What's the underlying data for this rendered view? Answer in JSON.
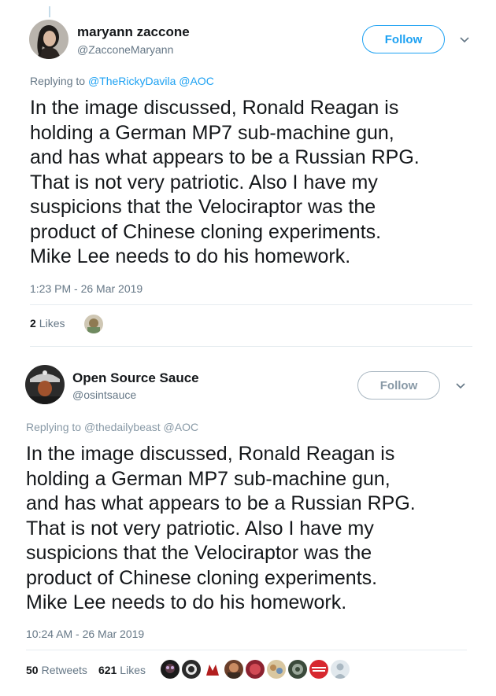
{
  "tweets": [
    {
      "display_name": "maryann zaccone",
      "handle": "@ZacconeMaryann",
      "follow_label": "Follow",
      "reply_prefix": "Replying to",
      "reply_mentions": [
        "@TheRickyDavila",
        "@AOC"
      ],
      "text": "In the image discussed, Ronald Reagan is\nholding a German MP7 sub-machine gun,\nand has what appears to be a Russian RPG.\nThat is not very patriotic. Also I have my\nsuspicions that the Velociraptor was the\nproduct of Chinese cloning experiments.\nMike Lee needs to do his homework.",
      "timestamp": "1:23 PM - 26 Mar 2019",
      "likes_count": "2",
      "likes_label": "Likes"
    },
    {
      "display_name": "Open Source Sauce",
      "handle": "@osintsauce",
      "follow_label": "Follow",
      "reply_prefix": "Replying to",
      "reply_mentions": [
        "@thedailybeast",
        "@AOC"
      ],
      "text": "In the image discussed, Ronald Reagan is\nholding a German MP7 sub-machine gun,\nand has what appears to be a Russian RPG.\nThat is not very patriotic. Also I have my\nsuspicions that the Velociraptor was the\nproduct of Chinese cloning experiments.\nMike Lee needs to do his homework.",
      "timestamp": "10:24 AM - 26 Mar 2019",
      "retweets_count": "50",
      "retweets_label": "Retweets",
      "likes_count": "621",
      "likes_label": "Likes"
    }
  ],
  "colors": {
    "link": "#1da1f2",
    "muted": "#657786",
    "text": "#14171a",
    "divider": "#e6ecf0"
  },
  "icons": [
    "chevron-down-icon"
  ]
}
